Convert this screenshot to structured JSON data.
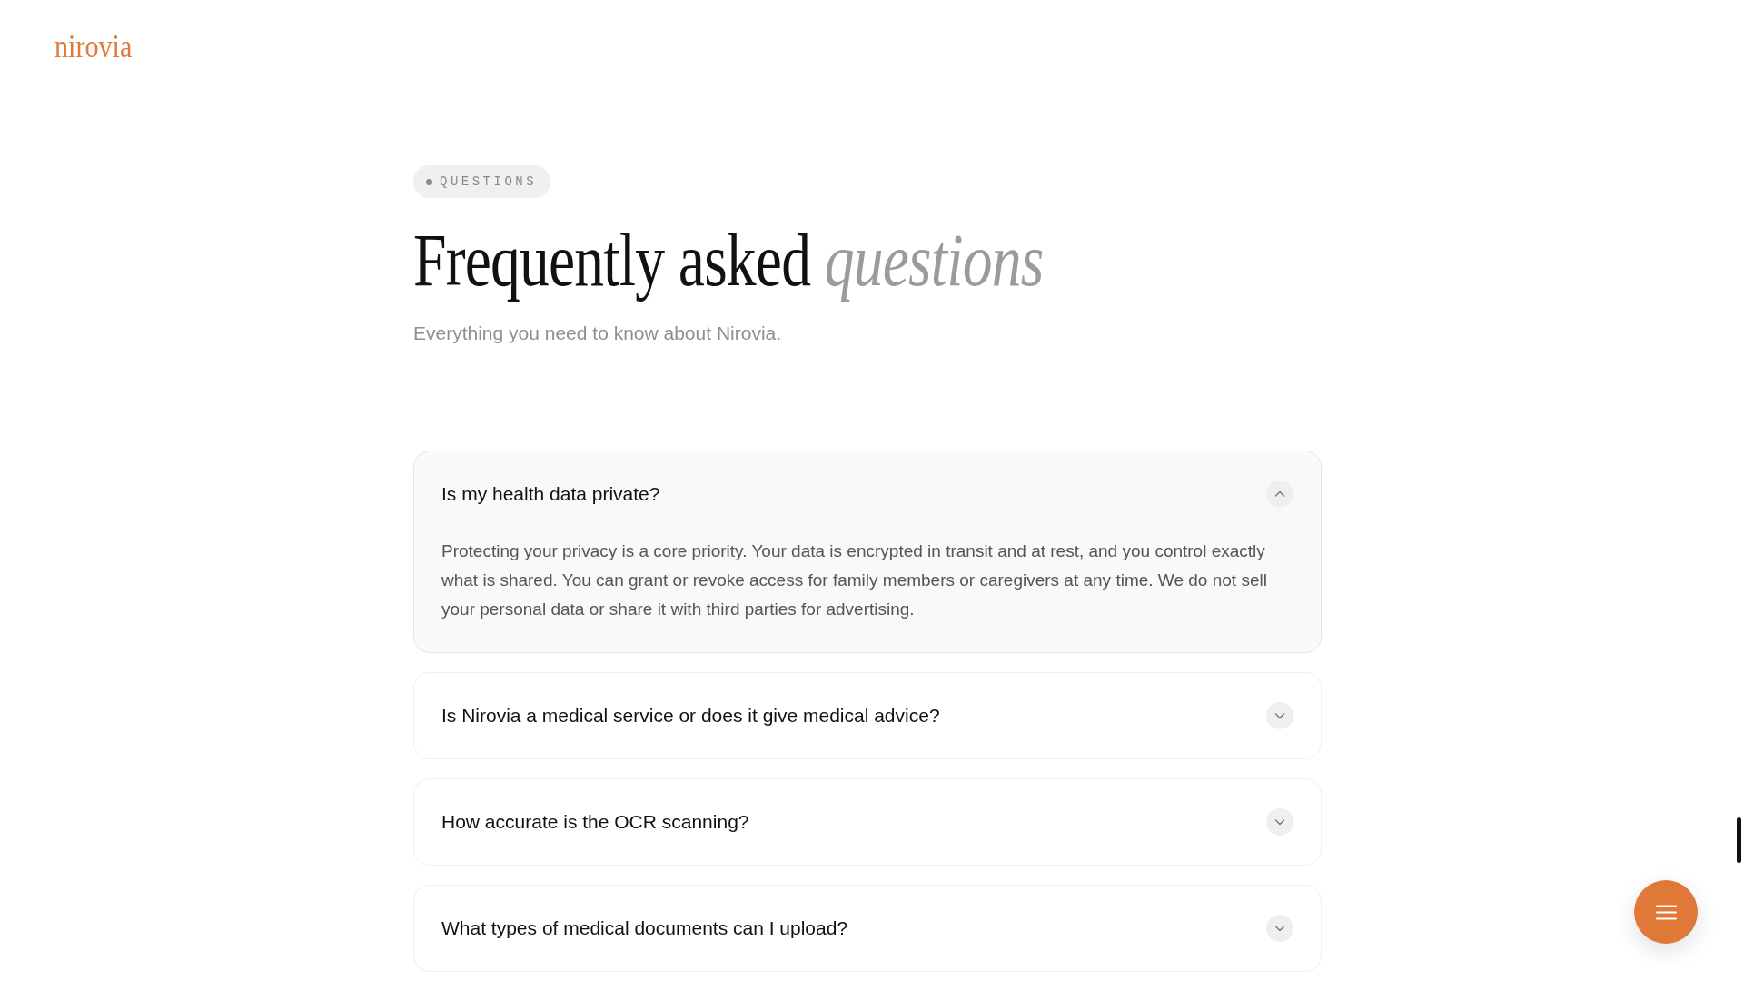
{
  "logo": "nirovia",
  "section_tag": "QUESTIONS",
  "heading": {
    "text": "Frequently asked",
    "emphasis": "questions"
  },
  "subtitle": "Everything you need to know about Nirovia.",
  "faq": [
    {
      "question": "Is my health data private?",
      "expanded": true,
      "answer": "Protecting your privacy is a core priority. Your data is encrypted in transit and at rest, and you control exactly what is shared. You can grant or revoke access for family members or caregivers at any time. We do not sell your personal data or share it with third parties for advertising."
    },
    {
      "question": "Is Nirovia a medical service or does it give medical advice?",
      "expanded": false
    },
    {
      "question": "How accurate is the OCR scanning?",
      "expanded": false
    },
    {
      "question": "What types of medical documents can I upload?",
      "expanded": false
    }
  ]
}
